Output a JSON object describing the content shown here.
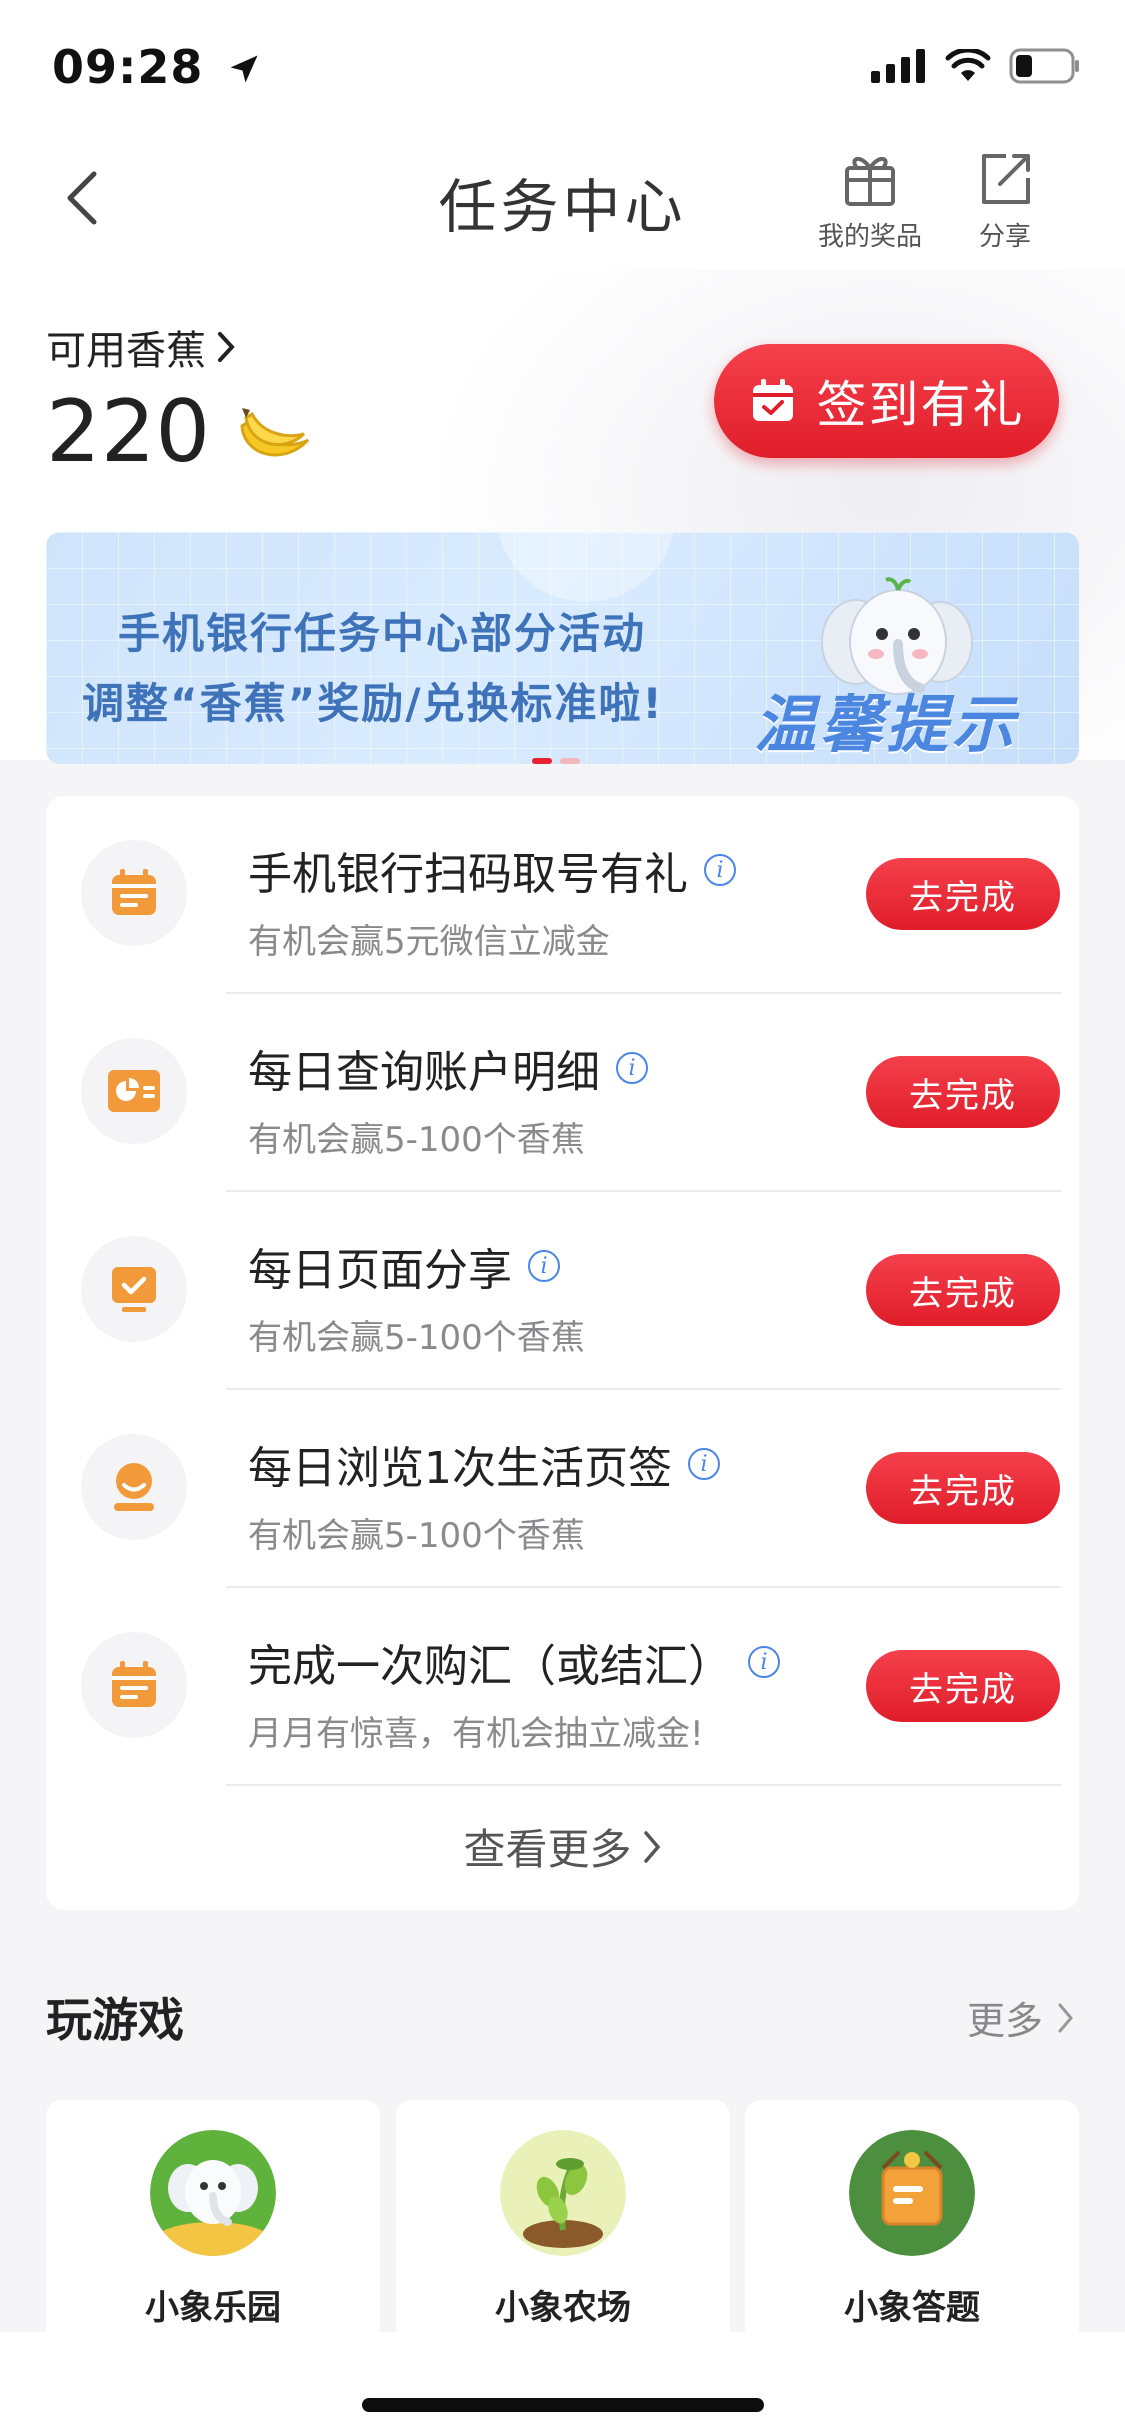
{
  "status_bar": {
    "time": "09:28"
  },
  "nav": {
    "title": "任务中心",
    "prizes_label": "我的奖品",
    "share_label": "分享"
  },
  "bananas": {
    "label": "可用香蕉",
    "count": "220",
    "checkin_label": "签到有礼"
  },
  "banner": {
    "line1": "手机银行任务中心部分活动",
    "line2": "调整“香蕉”奖励/兑换标准啦!",
    "tag": "温馨提示"
  },
  "tasks": [
    {
      "icon": "calendar-icon",
      "title": "手机银行扫码取号有礼",
      "subtitle": "有机会赢5元微信立减金",
      "button": "去完成"
    },
    {
      "icon": "chart-card-icon",
      "title": "每日查询账户明细",
      "subtitle": "有机会赢5-100个香蕉",
      "button": "去完成"
    },
    {
      "icon": "monitor-check-icon",
      "title": "每日页面分享",
      "subtitle": "有机会赢5-100个香蕉",
      "button": "去完成"
    },
    {
      "icon": "user-icon",
      "title": "每日浏览1次生活页签",
      "subtitle": "有机会赢5-100个香蕉",
      "button": "去完成"
    },
    {
      "icon": "calendar-icon",
      "title": "完成一次购汇（或结汇）",
      "subtitle": "月月有惊喜，有机会抽立减金!",
      "button": "去完成"
    }
  ],
  "see_more": "查看更多",
  "games": {
    "title": "玩游戏",
    "more": "更多",
    "items": [
      {
        "label": "小象乐园",
        "icon": "elephant-icon"
      },
      {
        "label": "小象农场",
        "icon": "sprout-icon"
      },
      {
        "label": "小象答题",
        "icon": "quiz-box-icon"
      }
    ]
  },
  "colors": {
    "accent_red": "#e01d2a",
    "task_icon_orange": "#f29a3a",
    "info_blue": "#4a86e8",
    "banner_text": "#3e72b9"
  }
}
